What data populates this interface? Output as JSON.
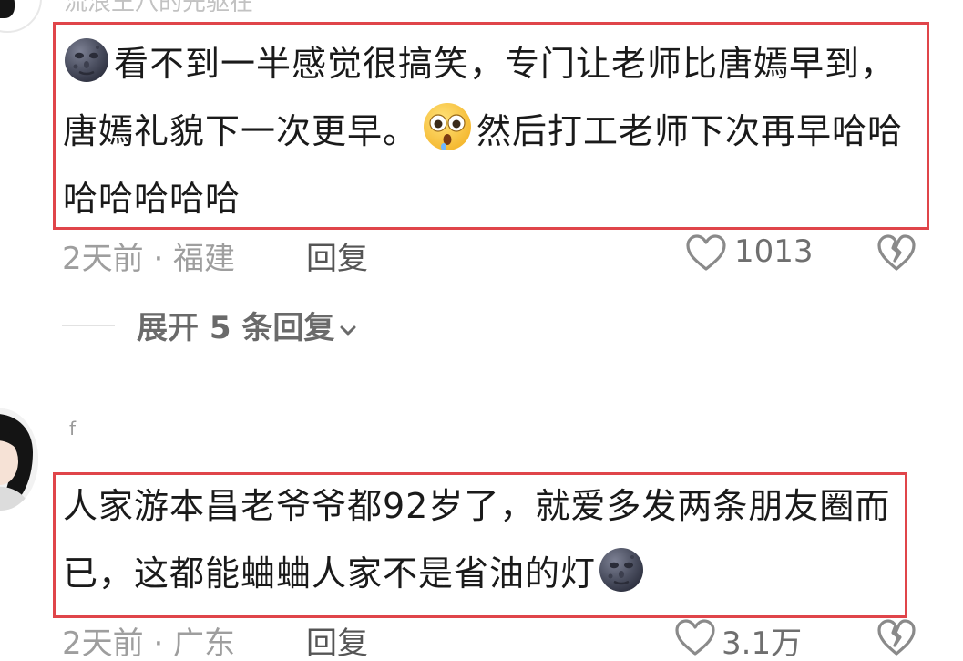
{
  "comment1": {
    "username": "流浪王八的先驱在",
    "text_a": "看不到一半感觉很搞笑，专门让老师比唐嫣早到，唐嫣礼貌下一次更早。",
    "text_b": "然后打工老师下次再早哈哈哈哈哈哈哈",
    "meta": "2天前 · 福建",
    "reply_label": "回复",
    "like_count": "1013"
  },
  "expand": {
    "label": "展开 5 条回复"
  },
  "comment2": {
    "username": "f",
    "text": "人家游本昌老爷爷都92岁了，就爱多发两条朋友圈而已，这都能蛐蛐人家不是省油的灯",
    "meta": "2天前 · 广东",
    "reply_label": "回复",
    "like_count": "3.1万"
  },
  "colors": {
    "highlight_border": "#e0454a",
    "text": "#1a1a1a",
    "meta": "#9e9e9e",
    "icon": "#8a8a8a"
  },
  "icons": {
    "moon": "new-moon-face-emoji",
    "shock": "flushed-face-emoji",
    "like": "heart-outline-icon",
    "dislike": "broken-heart-icon",
    "chevron": "chevron-down-icon"
  }
}
